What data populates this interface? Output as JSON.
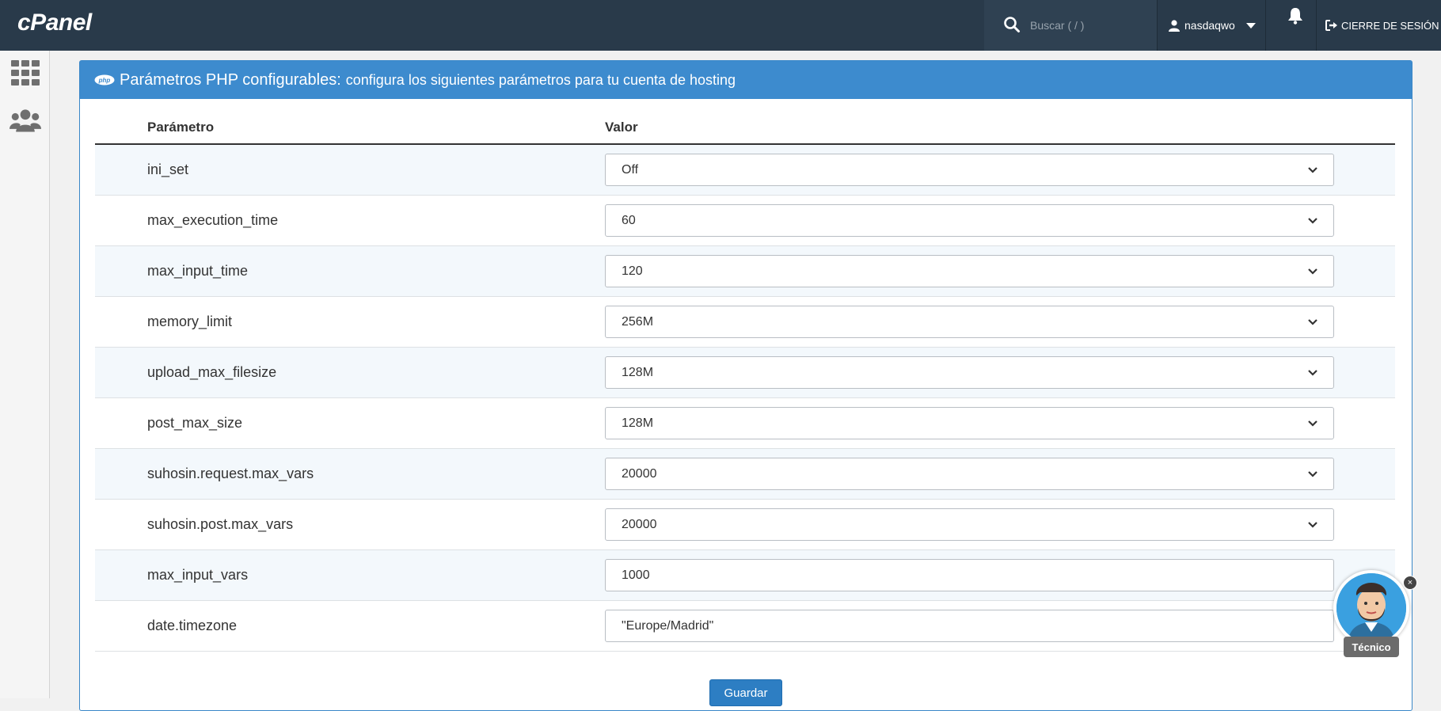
{
  "header": {
    "logo": "cPanel",
    "search_placeholder": "Buscar ( / )",
    "username": "nasdaqwo",
    "logout_label": "CIERRE DE SESIÓN"
  },
  "panel": {
    "title_main": "Parámetros PHP configurables:",
    "title_desc": "configura los siguientes parámetros para tu cuenta de hosting",
    "col_param": "Parámetro",
    "col_value": "Valor",
    "rows": [
      {
        "name": "ini_set",
        "value": "Off",
        "type": "select"
      },
      {
        "name": "max_execution_time",
        "value": "60",
        "type": "select"
      },
      {
        "name": "max_input_time",
        "value": "120",
        "type": "select"
      },
      {
        "name": "memory_limit",
        "value": "256M",
        "type": "select"
      },
      {
        "name": "upload_max_filesize",
        "value": "128M",
        "type": "select"
      },
      {
        "name": "post_max_size",
        "value": "128M",
        "type": "select"
      },
      {
        "name": "suhosin.request.max_vars",
        "value": "20000",
        "type": "select"
      },
      {
        "name": "suhosin.post.max_vars",
        "value": "20000",
        "type": "select"
      },
      {
        "name": "max_input_vars",
        "value": "1000",
        "type": "input"
      },
      {
        "name": "date.timezone",
        "value": "\"Europe/Madrid\"",
        "type": "input"
      }
    ],
    "save_label": "Guardar"
  },
  "chat": {
    "label": "Técnico",
    "close": "×"
  },
  "colors": {
    "topbar": "#293a4a",
    "panel_heading": "#3d8bce",
    "save_button": "#2d7ec3"
  }
}
